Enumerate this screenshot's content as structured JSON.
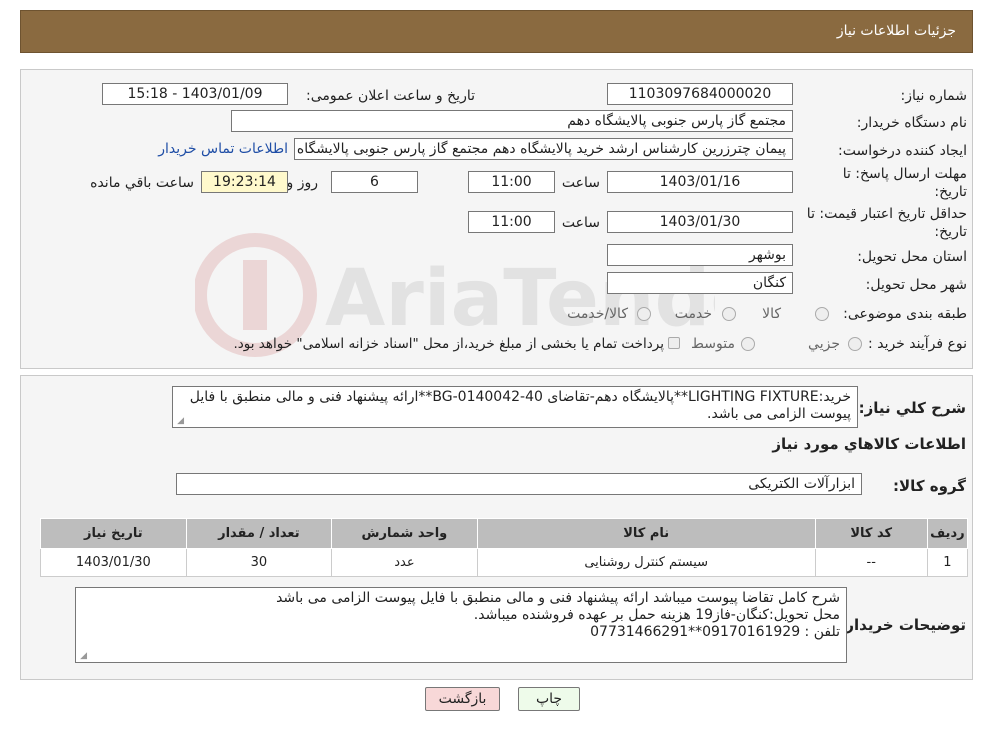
{
  "header": {
    "title": "جزئیات اطلاعات نیاز"
  },
  "form": {
    "need_number_label": "شماره نیاز:",
    "need_number": "1103097684000020",
    "announce_label": "تاریخ و ساعت اعلان عمومی:",
    "announce_value": "1403/01/09 - 15:18",
    "buyer_label": "نام دستگاه خریدار:",
    "buyer_value": "مجتمع گاز پارس جنوبی  پالایشگاه دهم",
    "creator_label": "ایجاد کننده درخواست:",
    "creator_value": "پیمان چترزرین کارشناس ارشد خرید پالایشگاه دهم مجتمع گاز پارس جنوبی  پالایشگاه دهم",
    "contact_link": "اطلاعات تماس خریدار",
    "deadline_label_1": "مهلت ارسال پاسخ: تا",
    "deadline_label_2": "تاریخ:",
    "deadline_date": "1403/01/16",
    "time_label": "ساعت",
    "deadline_time": "11:00",
    "days_value": "6",
    "days_label": "روز و",
    "remaining_time": "19:23:14",
    "remaining_label": "ساعت باقي مانده",
    "validity_label_1": "حداقل تاریخ اعتبار قیمت: تا",
    "validity_label_2": "تاریخ:",
    "validity_date": "1403/01/30",
    "validity_time": "11:00",
    "province_label": "استان محل تحویل:",
    "province_value": "بوشهر",
    "city_label": "شهر محل تحویل:",
    "city_value": "کنگان",
    "category_label": "طبقه بندی موضوعی:",
    "category_options": [
      "کالا",
      "خدمت",
      "کالا/خدمت"
    ],
    "process_label": "نوع فرآیند خرید :",
    "process_options": [
      "جزيي",
      "متوسط"
    ],
    "process_note": "پرداخت تمام یا بخشی از مبلغ خرید،از محل \"اسناد خزانه اسلامی\" خواهد بود."
  },
  "summary": {
    "label": "شرح کلي نياز:",
    "text": "خرید:LIGHTING FIXTURE**پالایشگاه دهم-تقاضای BG-0140042-40**ارائه پیشنهاد فنی و مالی منطبق با فایل پیوست الزامی می باشد."
  },
  "goods_section": {
    "title": "اطلاعات کالاهاي مورد نياز",
    "group_label": "گروه کالا:",
    "group_value": "ابزارآلات الکتریکی"
  },
  "table": {
    "headers": [
      "رديف",
      "کد کالا",
      "نام کالا",
      "واحد شمارش",
      "تعداد / مقدار",
      "تاریخ نیاز"
    ],
    "rows": [
      [
        "1",
        "--",
        "سیستم کنترل روشنایی",
        "عدد",
        "30",
        "1403/01/30"
      ]
    ]
  },
  "buyer_notes": {
    "label": "توضيحات خريدار:",
    "lines": [
      "شرح کامل تقاضا پیوست میباشد ارائه پیشنهاد فنی و مالی منطبق با فایل پیوست الزامی می باشد",
      "محل تحویل:کنگان-فاز19 هزینه حمل بر عهده فروشنده میباشد.",
      "تلفن : 09170161929**07731466291"
    ]
  },
  "buttons": {
    "print": "چاپ",
    "back": "بازگشت"
  },
  "colors": {
    "header_bg": "#8a6a40",
    "back_button_bg": "#f8d8d8",
    "print_button_bg": "#eefbea"
  }
}
